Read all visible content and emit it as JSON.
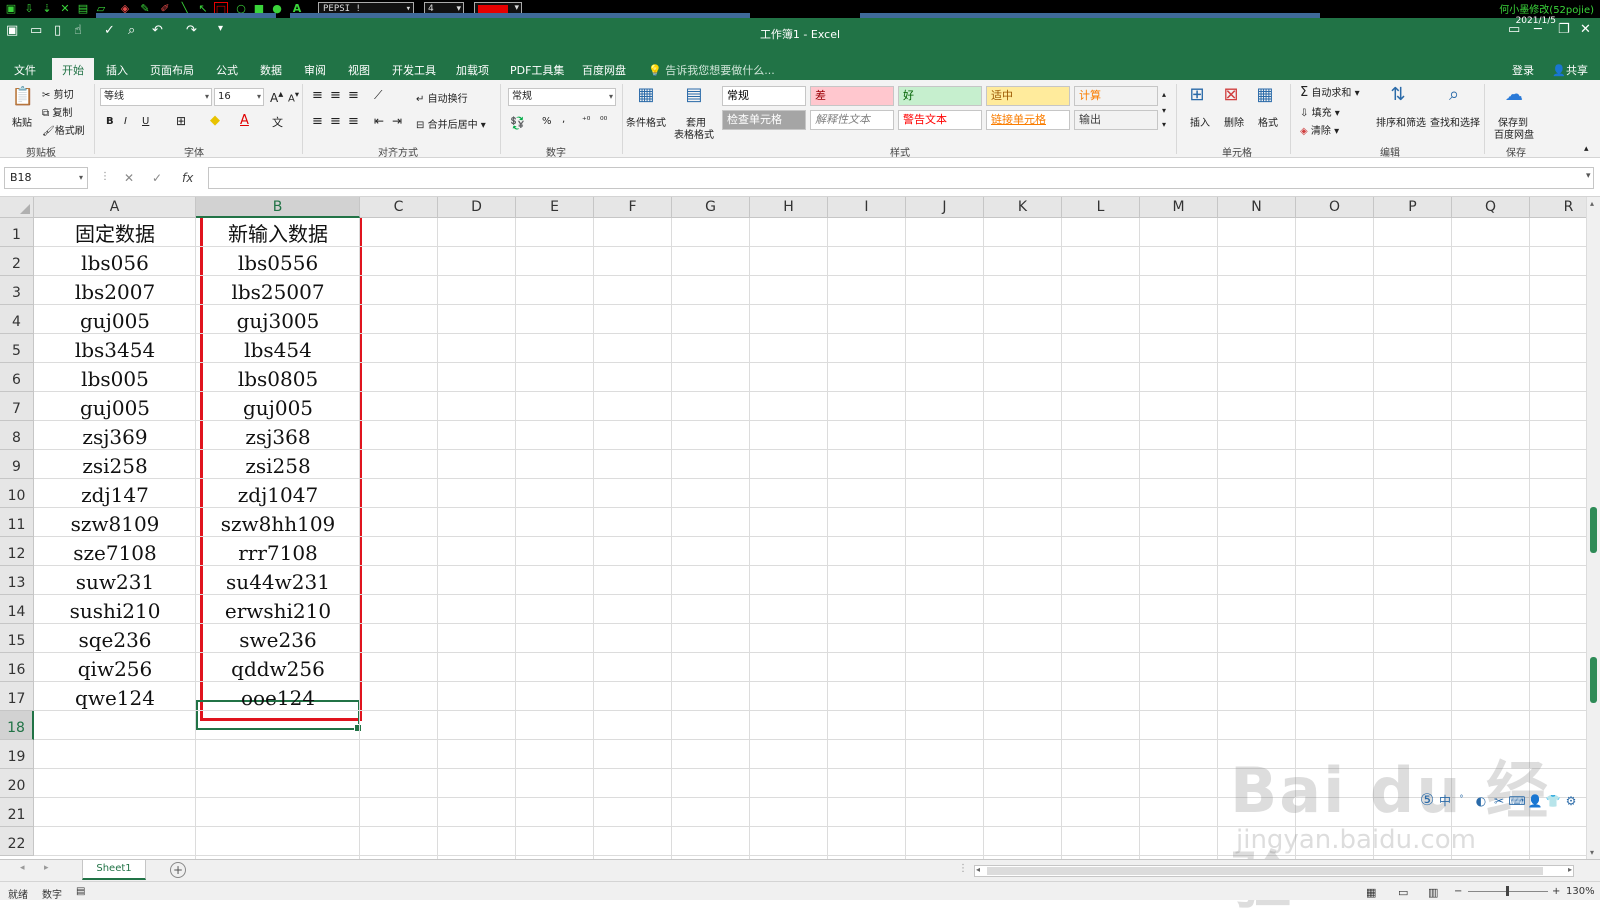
{
  "topstrip": {
    "font_name": "PEPSI !",
    "font_size": "4",
    "right_text": "何小墨修改(52pojie)"
  },
  "titlebar": {
    "title": "工作簿1 - Excel",
    "date": "2021/1/5"
  },
  "tabs": [
    "文件",
    "开始",
    "插入",
    "页面布局",
    "公式",
    "数据",
    "审阅",
    "视图",
    "开发工具",
    "加载项",
    "PDF工具集",
    "百度网盘"
  ],
  "active_tab": "开始",
  "tell_me": "告诉我您想要做什么...",
  "login": "登录",
  "share": "共享",
  "ribbon": {
    "clipboard": {
      "paste": "粘贴",
      "cut": "剪切",
      "copy": "复制",
      "format_painter": "格式刷",
      "label": "剪贴板"
    },
    "font": {
      "font_name": "等线",
      "font_size": "16",
      "bold": "B",
      "italic": "I",
      "underline": "U",
      "label": "字体"
    },
    "alignment": {
      "wrap": "自动换行",
      "merge": "合并后居中",
      "label": "对齐方式"
    },
    "number": {
      "format": "常规",
      "percent": "%",
      "comma": ",",
      "label": "数字"
    },
    "styles": {
      "conditional": "条件格式",
      "table": "套用",
      "table2": "表格格式",
      "cells": [
        {
          "text": "常规",
          "bg": "#ffffff",
          "fg": "#000000"
        },
        {
          "text": "差",
          "bg": "#ffc7ce",
          "fg": "#9c0006"
        },
        {
          "text": "好",
          "bg": "#c6efce",
          "fg": "#006100"
        },
        {
          "text": "适中",
          "bg": "#ffeb9c",
          "fg": "#9c5700"
        },
        {
          "text": "计算",
          "bg": "#f2f2f2",
          "fg": "#fa7d00"
        },
        {
          "text": "检查单元格",
          "bg": "#a5a5a5",
          "fg": "#ffffff"
        },
        {
          "text": "解释性文本",
          "bg": "#ffffff",
          "fg": "#7f7f7f"
        },
        {
          "text": "警告文本",
          "bg": "#ffffff",
          "fg": "#ff0000"
        },
        {
          "text": "链接单元格",
          "bg": "#ffffff",
          "fg": "#fa7d00"
        },
        {
          "text": "输出",
          "bg": "#f2f2f2",
          "fg": "#3f3f3f"
        }
      ],
      "label": "样式"
    },
    "cells_group": {
      "insert": "插入",
      "delete": "删除",
      "format": "格式",
      "label": "单元格"
    },
    "editing": {
      "autosum": "自动求和",
      "fill": "填充",
      "clear": "清除",
      "sort": "排序和筛选",
      "find": "查找和选择",
      "label": "编辑"
    },
    "save": {
      "save_to": "保存到",
      "save_to2": "百度网盘",
      "label": "保存"
    }
  },
  "name_box": "B18",
  "formula_buttons": {
    "cancel": "✕",
    "enter": "✓",
    "fx": "fx"
  },
  "columns": [
    "A",
    "B",
    "C",
    "D",
    "E",
    "F",
    "G",
    "H",
    "I",
    "J",
    "K",
    "L",
    "M",
    "N",
    "O",
    "P",
    "Q",
    "R"
  ],
  "rows": [
    "1",
    "2",
    "3",
    "4",
    "5",
    "6",
    "7",
    "8",
    "9",
    "10",
    "11",
    "12",
    "13",
    "14",
    "15",
    "16",
    "17",
    "18",
    "19",
    "20",
    "21",
    "22"
  ],
  "table": {
    "col_a": [
      "固定数据",
      "lbs056",
      "lbs2007",
      "guj005",
      "lbs3454",
      "lbs005",
      "guj005",
      "zsj369",
      "zsi258",
      "zdj147",
      "szw8109",
      "sze7108",
      "suw231",
      "sushi210",
      "sqe236",
      "qiw256",
      "qwe124"
    ],
    "col_b": [
      "新输入数据",
      "lbs0556",
      "lbs25007",
      "guj3005",
      "lbs454",
      "lbs0805",
      "guj005",
      "zsj368",
      "zsi258",
      "zdj1047",
      "szw8hh109",
      "rrr7108",
      "su44w231",
      "erwshi210",
      "swe236",
      "qddw256",
      "ooe124"
    ]
  },
  "sheet_tab": "Sheet1",
  "status": {
    "ready": "就绪",
    "num": "数字",
    "zoom": "130%"
  },
  "watermark": {
    "main": "Bai du 经验",
    "sub": "jingyan.baidu.com"
  }
}
